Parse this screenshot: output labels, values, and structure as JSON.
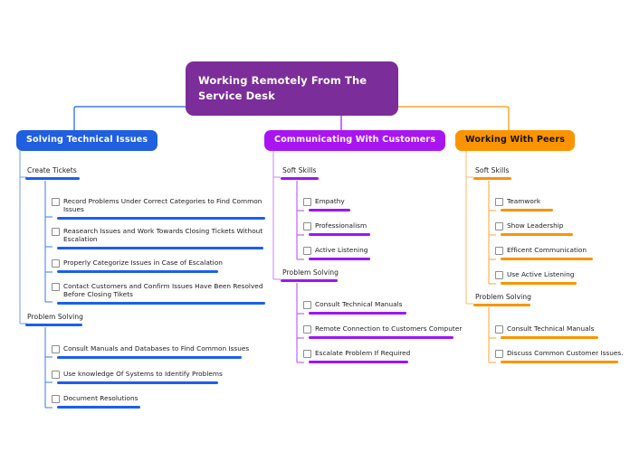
{
  "colors": {
    "root": "#7b2d99",
    "blue": "#1a5ff0",
    "purple": "#9d15f5",
    "orange": "#fb9400",
    "background": "#ffffff"
  },
  "root": {
    "title": "Working Remotely From The Service Desk"
  },
  "branches": [
    {
      "id": "solving-technical-issues",
      "label": "Solving Technical Issues",
      "color": "#1a5ff0",
      "groups": [
        {
          "label": "Create Tickets",
          "items": [
            "Record Problems Under Correct Categories to Find Common Issues",
            "Reasearch Issues and Work Towards Closing Tickets Without Escalation",
            "Properly Categorize Issues in Case of Escalation",
            "Contact Customers and Confirm Issues Have  Been Resolved Before Closing Tikets"
          ]
        },
        {
          "label": "Problem Solving",
          "items": [
            "Consult Manuals and Databases to Find Common Issues",
            "Use knowledge Of Systems to Identify Problems",
            "Document Resolutions"
          ]
        }
      ]
    },
    {
      "id": "communicating-with-customers",
      "label": "Communicating With Customers",
      "color": "#9d15f5",
      "groups": [
        {
          "label": "Soft Skills",
          "items": [
            "Empathy",
            "Professionalism",
            "Active Listening"
          ]
        },
        {
          "label": "Problem Solving",
          "items": [
            "Consult Technical Manuals",
            "Remote Connection to Customers Computer",
            "Escalate Problem If Required"
          ]
        }
      ]
    },
    {
      "id": "working-with-peers",
      "label": "Working With Peers",
      "color": "#fb9400",
      "groups": [
        {
          "label": "Soft Skills",
          "items": [
            "Teamwork",
            "Show Leadership",
            "Efficent Communication",
            "Use Active Listening"
          ]
        },
        {
          "label": "Problem Solving",
          "items": [
            "Consult Technical Manuals",
            "Discuss Common Customer Issues."
          ]
        }
      ]
    }
  ]
}
